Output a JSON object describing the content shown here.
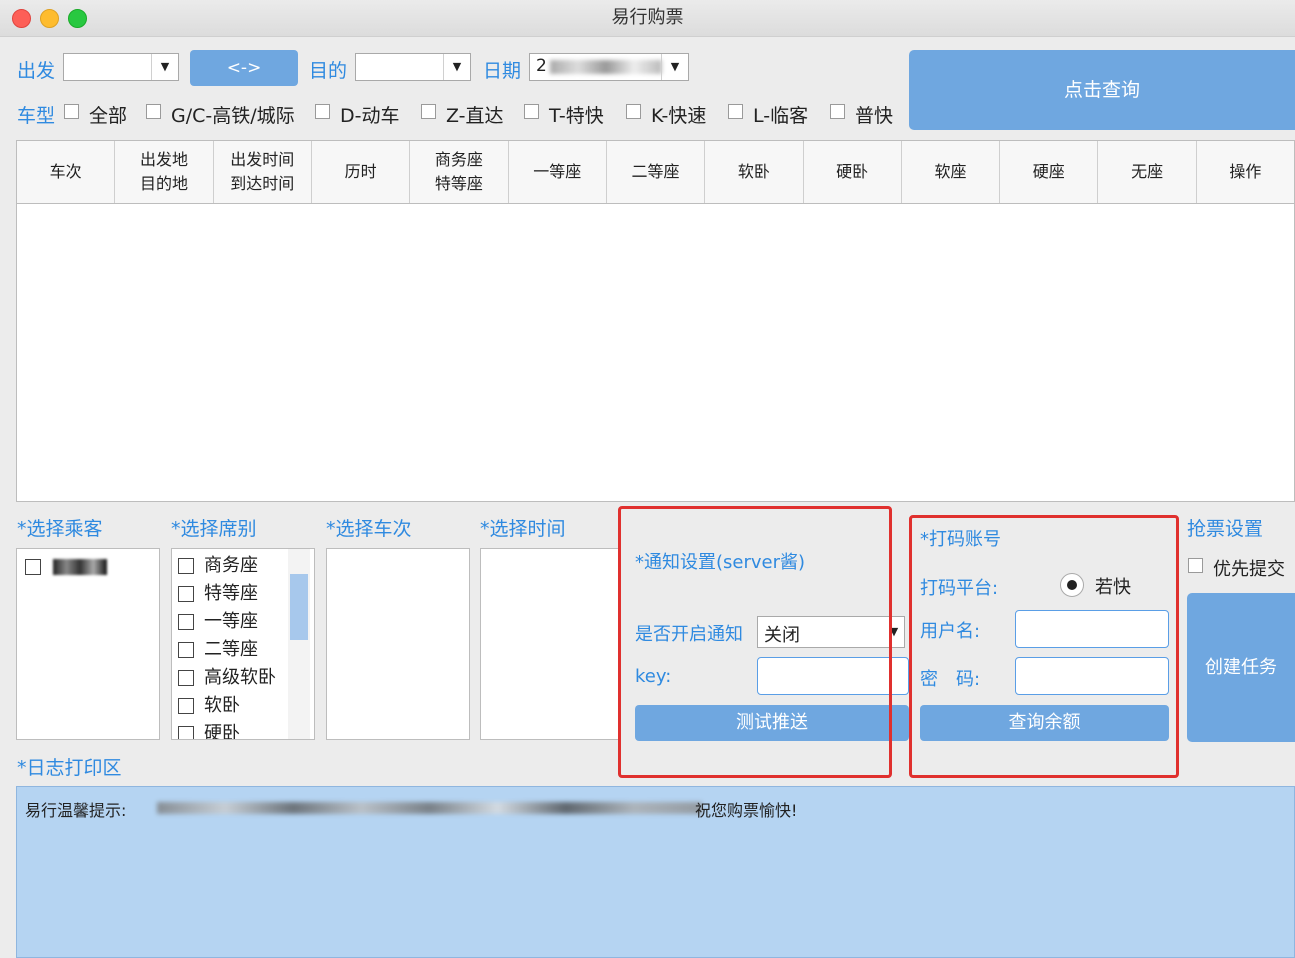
{
  "window": {
    "title": "易行购票"
  },
  "search": {
    "from_label": "出发",
    "swap_label": "<->",
    "to_label": "目的",
    "date_label": "日期",
    "date_value": "2",
    "query_label": "点击查询"
  },
  "train_types": {
    "label": "车型",
    "options": [
      "全部",
      "G/C-高铁/城际",
      "D-动车",
      "Z-直达",
      "T-特快",
      "K-快速",
      "L-临客",
      "普快"
    ]
  },
  "table": {
    "headers": [
      [
        "车次"
      ],
      [
        "出发地",
        "目的地"
      ],
      [
        "出发时间",
        "到达时间"
      ],
      [
        "历时"
      ],
      [
        "商务座",
        "特等座"
      ],
      [
        "一等座"
      ],
      [
        "二等座"
      ],
      [
        "软卧"
      ],
      [
        "硬卧"
      ],
      [
        "软座"
      ],
      [
        "硬座"
      ],
      [
        "无座"
      ],
      [
        "操作"
      ]
    ]
  },
  "passengers": {
    "label": "*选择乘客"
  },
  "seats": {
    "label": "*选择席别",
    "options": [
      "商务座",
      "特等座",
      "一等座",
      "二等座",
      "高级软卧",
      "软卧",
      "硬卧"
    ]
  },
  "trains": {
    "label": "*选择车次"
  },
  "times": {
    "label": "*选择时间"
  },
  "notify": {
    "title": "*通知设置(server酱)",
    "enable_label": "是否开启通知",
    "enable_value": "关闭",
    "key_label": "key:",
    "test_label": "测试推送"
  },
  "captcha": {
    "title": "*打码账号",
    "platform_label": "打码平台:",
    "platform_value": "若快",
    "user_label": "用户名:",
    "pass_label": "密　码:",
    "balance_label": "查询余额"
  },
  "grab": {
    "title": "抢票设置",
    "priority_label": "优先提交",
    "create_label": "创建任务"
  },
  "log": {
    "label": "*日志打印区",
    "prefix": "易行温馨提示:",
    "suffix": "祝您购票愉快!"
  }
}
